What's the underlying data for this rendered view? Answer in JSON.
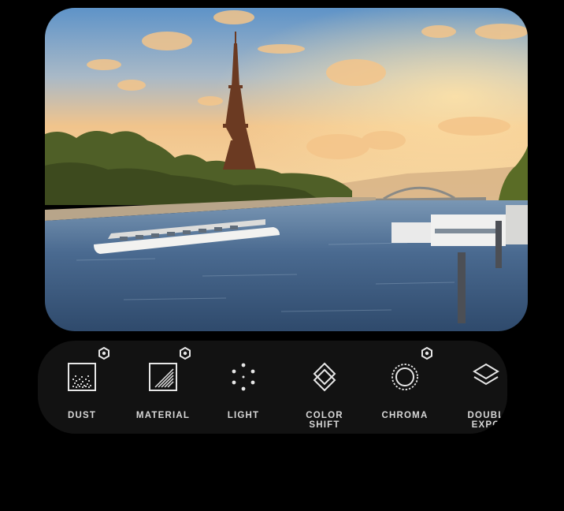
{
  "photo": {
    "subject": "eiffel-tower-seine-sunset",
    "colors": {
      "sky_top": "#6f9fcf",
      "sky_mid": "#f0c28a",
      "horizon": "#f6d39c",
      "water": "#3f5f86",
      "trees": "#5b6b2a"
    }
  },
  "tools": [
    {
      "name": "dust",
      "label": "DUST",
      "icon": "dust-icon",
      "has_settings": true
    },
    {
      "name": "material",
      "label": "MATERIAL",
      "icon": "material-icon",
      "has_settings": true
    },
    {
      "name": "light",
      "label": "LIGHT",
      "icon": "light-icon",
      "has_settings": false
    },
    {
      "name": "color-shift",
      "label": "COLOR\nSHIFT",
      "icon": "color-shift-icon",
      "has_settings": false
    },
    {
      "name": "chroma",
      "label": "CHROMA",
      "icon": "chroma-icon",
      "has_settings": true
    },
    {
      "name": "double-exposure",
      "label": "DOUBL\nEXPO",
      "icon": "layers-icon",
      "has_settings": false
    }
  ],
  "theme": {
    "background": "#000000",
    "toolbar_bg": "#121212",
    "icon_color": "#e6e6e6",
    "label_color": "#d8d8d8"
  }
}
